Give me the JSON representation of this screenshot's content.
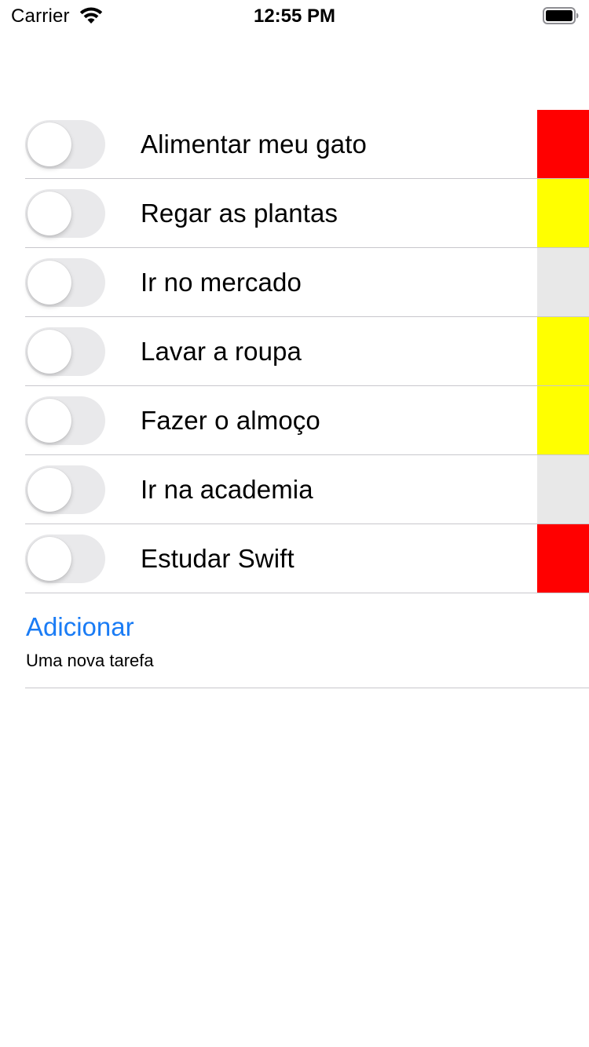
{
  "status_bar": {
    "carrier": "Carrier",
    "time": "12:55 PM",
    "wifi_icon": "wifi-icon",
    "battery_icon": "battery-icon",
    "battery_level": 1.0
  },
  "tasks": [
    {
      "title": "Alimentar meu gato",
      "done": false,
      "priority_color": "#ff0000"
    },
    {
      "title": "Regar as plantas",
      "done": false,
      "priority_color": "#ffff00"
    },
    {
      "title": "Ir no mercado",
      "done": false,
      "priority_color": "#e8e8e8"
    },
    {
      "title": "Lavar a roupa",
      "done": false,
      "priority_color": "#ffff00"
    },
    {
      "title": "Fazer o almoço",
      "done": false,
      "priority_color": "#ffff00"
    },
    {
      "title": "Ir na academia",
      "done": false,
      "priority_color": "#e8e8e8"
    },
    {
      "title": "Estudar Swift",
      "done": false,
      "priority_color": "#ff0000"
    }
  ],
  "add": {
    "button_label": "Adicionar",
    "placeholder": "Uma nova tarefa",
    "value": ""
  },
  "colors": {
    "accent": "#1a7cf5",
    "toggle_off": "#e9e9eb",
    "separator": "#c8c7cc"
  }
}
